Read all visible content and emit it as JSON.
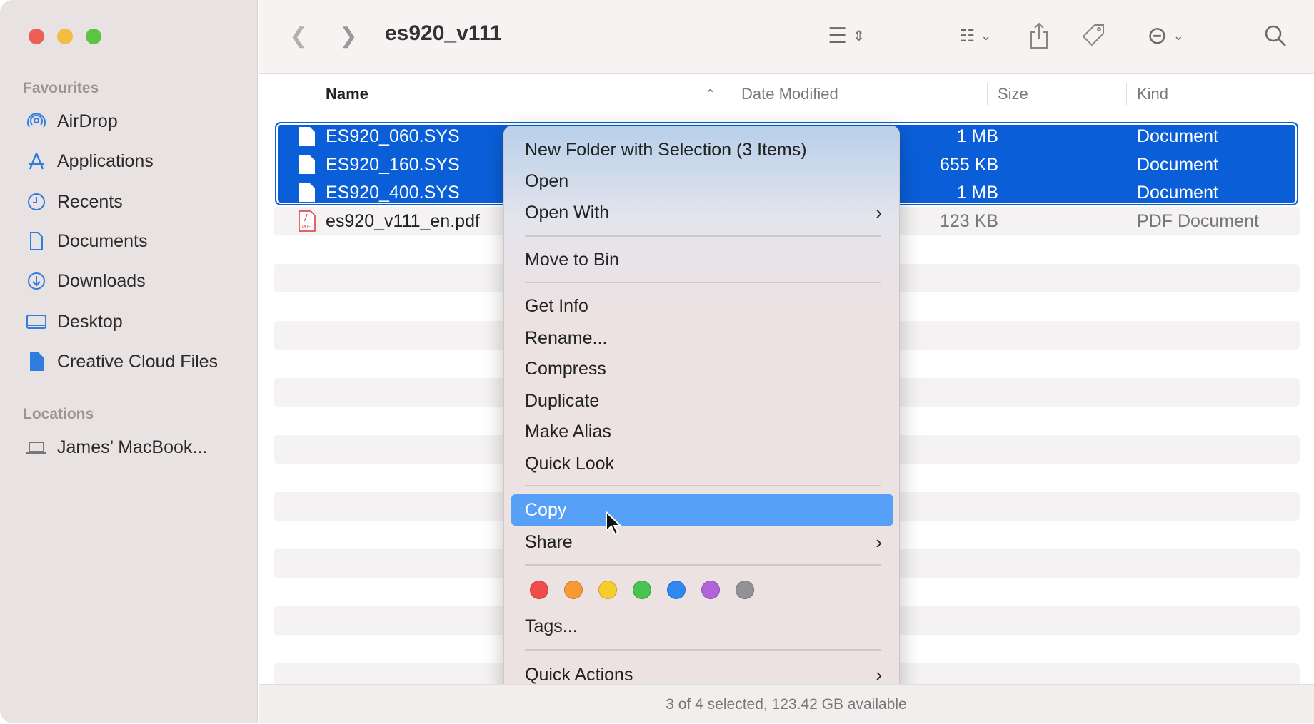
{
  "window": {
    "title": "es920_v111"
  },
  "sidebar": {
    "favourites_label": "Favourites",
    "items": [
      {
        "label": "AirDrop",
        "icon": "airdrop-icon"
      },
      {
        "label": "Applications",
        "icon": "applications-icon"
      },
      {
        "label": "Recents",
        "icon": "clock-icon"
      },
      {
        "label": "Documents",
        "icon": "document-icon"
      },
      {
        "label": "Downloads",
        "icon": "download-icon"
      },
      {
        "label": "Desktop",
        "icon": "desktop-icon"
      },
      {
        "label": "Creative Cloud Files",
        "icon": "file-icon"
      }
    ],
    "locations_label": "Locations",
    "locations": [
      {
        "label": "James’ MacBook...",
        "icon": "laptop-icon"
      }
    ]
  },
  "columns": {
    "name": "Name",
    "date": "Date Modified",
    "size": "Size",
    "kind": "Kind"
  },
  "files": [
    {
      "name": "ES920_060.SYS",
      "size": "1 MB",
      "kind": "Document",
      "selected": true
    },
    {
      "name": "ES920_160.SYS",
      "size": "655 KB",
      "kind": "Document",
      "selected": true
    },
    {
      "name": "ES920_400.SYS",
      "size": "1 MB",
      "kind": "Document",
      "selected": true
    },
    {
      "name": "es920_v111_en.pdf",
      "size": "123 KB",
      "kind": "PDF Document",
      "selected": false
    }
  ],
  "menu": {
    "new_folder": "New Folder with Selection (3 Items)",
    "open": "Open",
    "open_with": "Open With",
    "move_to_bin": "Move to Bin",
    "get_info": "Get Info",
    "rename": "Rename...",
    "compress": "Compress",
    "duplicate": "Duplicate",
    "make_alias": "Make Alias",
    "quick_look": "Quick Look",
    "copy": "Copy",
    "share": "Share",
    "tags": "Tags...",
    "quick_actions": "Quick Actions",
    "tag_colors": [
      "#f24b4b",
      "#f89a34",
      "#f7cd2e",
      "#47c452",
      "#2f88f2",
      "#b064d8",
      "#929296"
    ]
  },
  "status": "3 of 4 selected, 123.42 GB available",
  "colors": {
    "selection": "#0a5fd9",
    "highlight": "#56a0f7"
  }
}
